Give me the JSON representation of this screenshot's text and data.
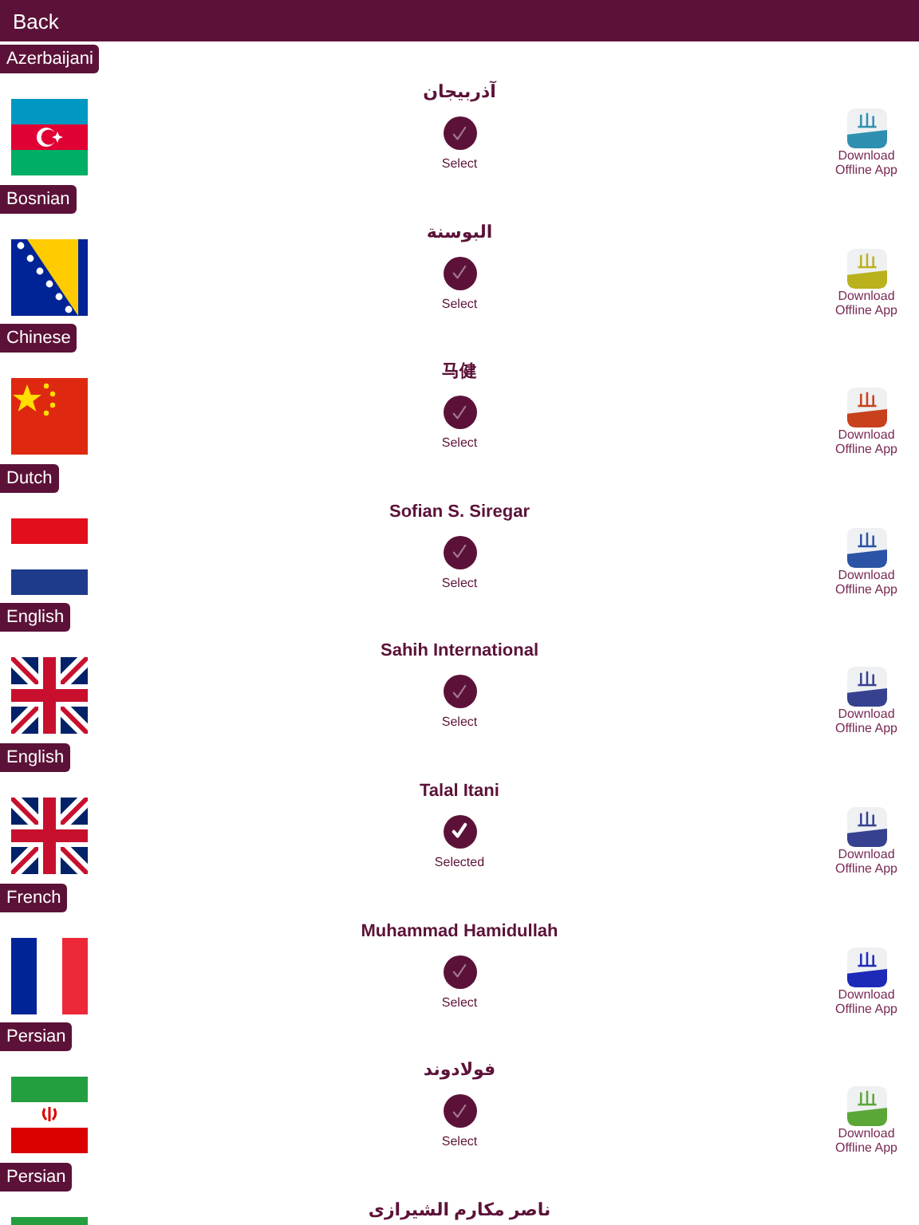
{
  "header": {
    "back": "Back"
  },
  "translations": [
    {
      "language": "Azerbaijani",
      "kind": "azerbaijan",
      "name": "آذربیجان",
      "selected": false,
      "status": "Select",
      "color": "#2f8fb0",
      "download": "Download\nOffline App"
    },
    {
      "language": "Bosnian",
      "kind": "bosnia",
      "name": "البوسنة",
      "selected": false,
      "status": "Select",
      "color": "#b9b21c",
      "download": "Download\nOffline App"
    },
    {
      "language": "Chinese",
      "kind": "china",
      "name": "马健",
      "selected": false,
      "status": "Select",
      "color": "#c8401c",
      "download": "Download\nOffline App"
    },
    {
      "language": "Dutch",
      "kind": "netherlands",
      "name": "Sofian S. Siregar",
      "selected": false,
      "status": "Select",
      "color": "#2b53a6",
      "download": "Download\nOffline App"
    },
    {
      "language": "English",
      "kind": "uk",
      "name": "Sahih International",
      "selected": false,
      "status": "Select",
      "color": "#36418f",
      "download": "Download\nOffline App"
    },
    {
      "language": "English",
      "kind": "uk",
      "name": "Talal Itani",
      "selected": true,
      "status": "Selected",
      "color": "#36418f",
      "download": "Download\nOffline App"
    },
    {
      "language": "French",
      "kind": "france",
      "name": "Muhammad Hamidullah",
      "selected": false,
      "status": "Select",
      "color": "#1d2ab8",
      "download": "Download\nOffline App"
    },
    {
      "language": "Persian",
      "kind": "iran",
      "name": "فولادوند",
      "selected": false,
      "status": "Select",
      "color": "#5aa637",
      "download": "Download\nOffline App"
    },
    {
      "language": "Persian",
      "kind": "iran",
      "name": "ناصر مكارم الشيرازى"
    }
  ]
}
